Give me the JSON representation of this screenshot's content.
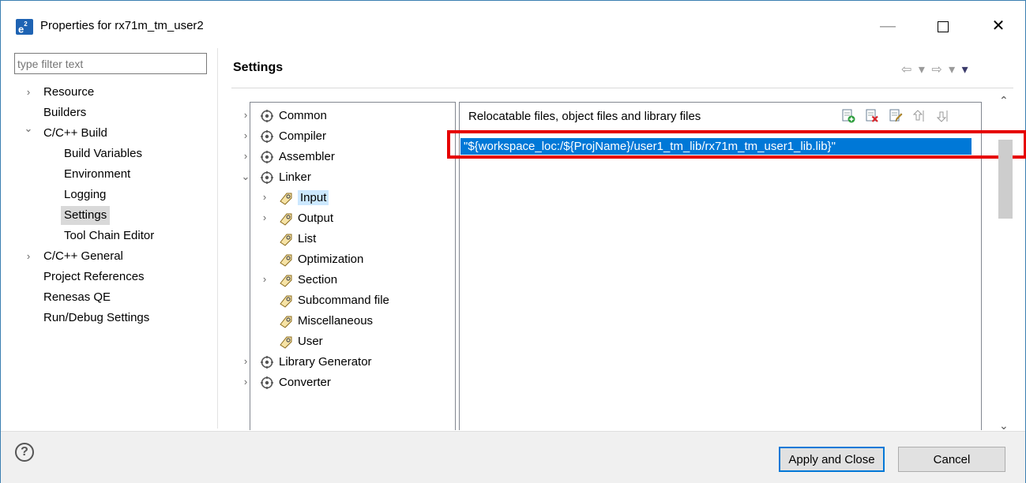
{
  "window": {
    "app_icon": "e²",
    "title": "Properties for rx71m_tm_user2",
    "controls": {
      "minimize": "—",
      "close": "✕"
    }
  },
  "filter": {
    "placeholder": "type filter text"
  },
  "nav": {
    "items": [
      {
        "label": "Resource",
        "chevron": "›"
      },
      {
        "label": "Builders"
      },
      {
        "label": "C/C++ Build",
        "chevron": "⌄"
      },
      {
        "label": "Build Variables"
      },
      {
        "label": "Environment"
      },
      {
        "label": "Logging"
      },
      {
        "label": "Settings",
        "selected": true
      },
      {
        "label": "Tool Chain Editor"
      },
      {
        "label": "C/C++ General",
        "chevron": "›"
      },
      {
        "label": "Project References"
      },
      {
        "label": "Renesas QE"
      },
      {
        "label": "Run/Debug Settings"
      }
    ]
  },
  "settings": {
    "title": "Settings",
    "nav_arrows": "⇦ ▾ ⇨ ▾"
  },
  "tool_tree": {
    "items": [
      {
        "label": "Common",
        "chevron": "›"
      },
      {
        "label": "Compiler",
        "chevron": "›"
      },
      {
        "label": "Assembler",
        "chevron": "›"
      },
      {
        "label": "Linker",
        "chevron": "⌄"
      },
      {
        "label": "Input",
        "chevron": "›",
        "selected": true
      },
      {
        "label": "Output",
        "chevron": "›"
      },
      {
        "label": "List"
      },
      {
        "label": "Optimization"
      },
      {
        "label": "Section",
        "chevron": "›"
      },
      {
        "label": "Subcommand file"
      },
      {
        "label": "Miscellaneous"
      },
      {
        "label": "User"
      },
      {
        "label": "Library Generator",
        "chevron": "›"
      },
      {
        "label": "Converter",
        "chevron": "›"
      }
    ]
  },
  "files": {
    "label": "Relocatable files, object files and library files",
    "entries": [
      "\"${workspace_loc:/${ProjName}/user1_tm_lib/rx71m_tm_user1_lib.lib}\""
    ],
    "toolbar_icons": [
      "add-icon",
      "delete-icon",
      "edit-icon",
      "move-up-icon",
      "move-down-icon"
    ]
  },
  "scrollbar": {
    "up": "⌃",
    "down": "⌄"
  },
  "footer": {
    "help": "?",
    "apply_close": "Apply and Close",
    "cancel": "Cancel"
  },
  "colors": {
    "selection": "#0078d7",
    "highlight_box": "#e60000",
    "tree_selection": "#cce8ff",
    "nav_selection": "#d9d9d9"
  }
}
